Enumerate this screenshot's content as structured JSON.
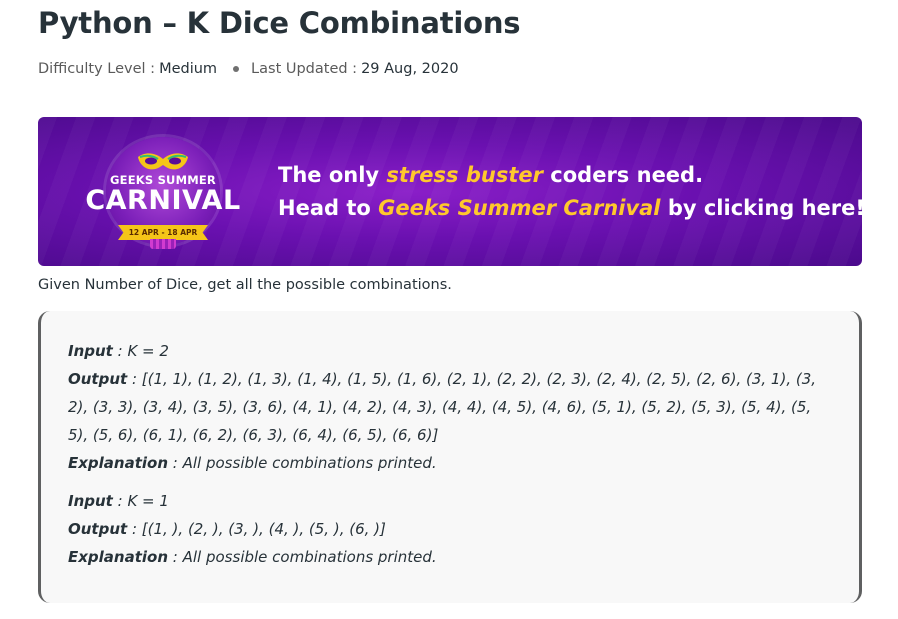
{
  "article": {
    "title": "Python – K Dice Combinations",
    "difficulty_label": "Difficulty Level :",
    "difficulty_value": "Medium",
    "updated_label": "Last Updated :",
    "updated_value": "29 Aug, 2020"
  },
  "banner": {
    "logo_top": "GEEKS SUMMER",
    "logo_main": "CARNIVAL",
    "logo_dates": "12 APR - 18 APR",
    "line1_prefix": "The only ",
    "line1_highlight": "stress buster",
    "line1_suffix": " coders need.",
    "line2_prefix": "Head to ",
    "line2_highlight": "Geeks Summer Carnival",
    "line2_suffix": " by clicking here!",
    "colors": {
      "background": "#6a10b0",
      "highlight": "#ffc82c"
    },
    "icon": "carnival-mask-icon"
  },
  "intro_text": "Given Number of Dice, get all the possible combinations.",
  "examples": [
    {
      "input_label": "Input",
      "input_value": " : K = 2",
      "output_label": "Output",
      "output_lines": [
        " : [(1, 1), (1, 2), (1, 3), (1, 4), (1, 5), (1, 6), (2, 1), (2, 2), (2, 3), (2, 4), (2, 5), (2, 6), (3, 1), (3,",
        "2), (3, 3), (3, 4), (3, 5), (3, 6), (4, 1), (4, 2), (4, 3), (4, 4), (4, 5), (4, 6), (5, 1), (5, 2), (5, 3), (5, 4), (5,",
        "5), (5, 6), (6, 1), (6, 2), (6, 3), (6, 4), (6, 5), (6, 6)]"
      ],
      "explanation_label": "Explanation",
      "explanation_value": " : All possible combinations printed."
    },
    {
      "input_label": "Input",
      "input_value": " : K = 1",
      "output_label": "Output",
      "output_lines": [
        " : [(1, ), (2, ), (3, ), (4, ), (5, ), (6, )]"
      ],
      "explanation_label": "Explanation",
      "explanation_value": " : All possible combinations printed."
    }
  ]
}
